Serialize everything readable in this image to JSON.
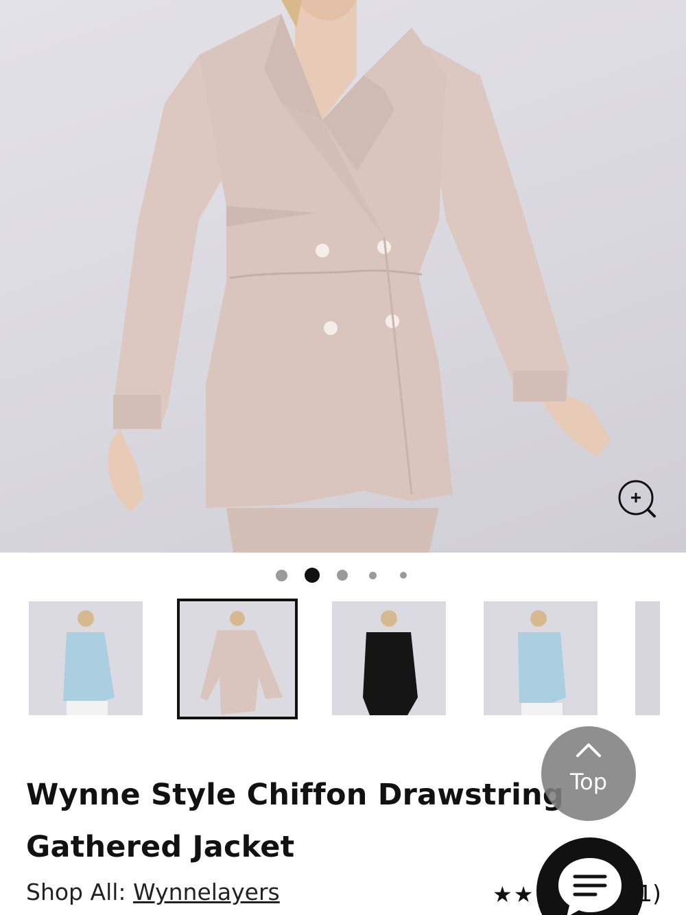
{
  "product": {
    "title_line1": "Wynne Style Chiffon Drawstring",
    "title_line2": "Gathered Jacket",
    "shop_all_label": "Shop All:",
    "shop_all_link": "Wynnelayers",
    "rating_stars": 2,
    "rating_stars_text": "★★",
    "review_count": "1)"
  },
  "gallery": {
    "dot_count": 5,
    "active_dot": 1,
    "thumbnails": [
      {
        "color_name": "light blue",
        "color": "#a9cfe0"
      },
      {
        "color_name": "taupe",
        "color": "#d9c5bd",
        "selected": true
      },
      {
        "color_name": "black",
        "color": "#151515"
      },
      {
        "color_name": "light blue",
        "color": "#a9cfe0"
      },
      {
        "color_name": "partial",
        "color": "#d6d6dc"
      }
    ]
  },
  "buttons": {
    "top_label": "Top",
    "zoom_icon": "zoom-in-icon",
    "chat_icon": "chat-icon"
  },
  "colors": {
    "jacket": "#d9c5bd",
    "background": "#dfdee4",
    "accent": "#111111",
    "top_button": "#808080"
  }
}
